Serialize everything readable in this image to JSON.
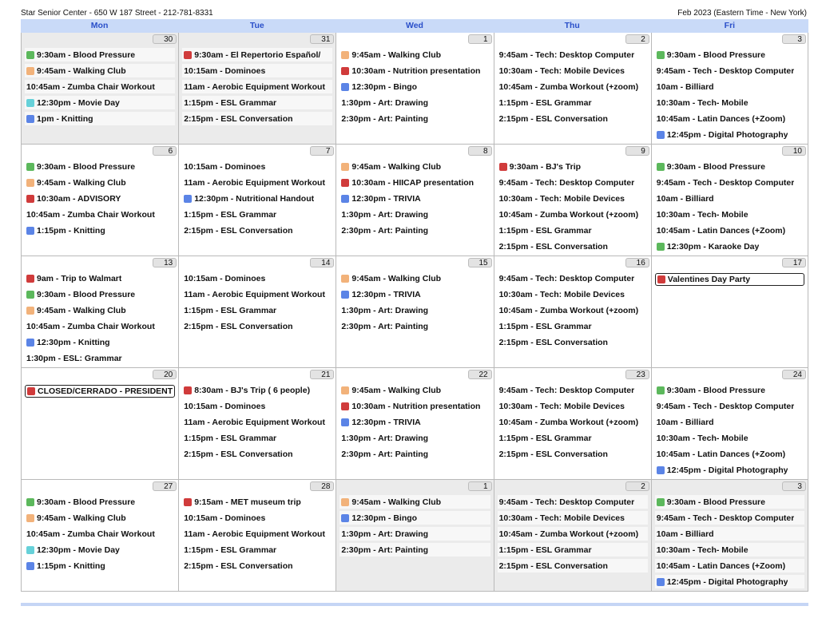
{
  "header": {
    "left": "Star Senior Center - 650 W 187 Street - 212-781-8331",
    "right": "Feb 2023 (Eastern Time - New York)"
  },
  "days_of_week": [
    "Mon",
    "Tue",
    "Wed",
    "Thu",
    "Fri"
  ],
  "weeks": [
    {
      "days": [
        {
          "num": "30",
          "gray": true,
          "events": [
            {
              "text": "9:30am - Blood Pressure",
              "color": "green"
            },
            {
              "text": "9:45am - Walking Club",
              "color": "orange"
            },
            {
              "text": "10:45am - Zumba Chair Workout"
            },
            {
              "text": "12:30pm - Movie Day",
              "color": "teal"
            },
            {
              "text": "1pm - Knitting",
              "color": "blue"
            }
          ]
        },
        {
          "num": "31",
          "gray": true,
          "events": [
            {
              "text": "9:30am - El Repertorio Español/",
              "color": "red"
            },
            {
              "text": "10:15am - Dominoes"
            },
            {
              "text": "11am - Aerobic Equipment Workout"
            },
            {
              "text": "1:15pm - ESL Grammar"
            },
            {
              "text": "2:15pm - ESL Conversation"
            }
          ]
        },
        {
          "num": "1",
          "events": [
            {
              "text": "9:45am - Walking Club",
              "color": "orange"
            },
            {
              "text": "10:30am - Nutrition presentation",
              "color": "red"
            },
            {
              "text": "12:30pm - Bingo",
              "color": "blue"
            },
            {
              "text": "1:30pm - Art: Drawing"
            },
            {
              "text": "2:30pm - Art: Painting"
            }
          ]
        },
        {
          "num": "2",
          "events": [
            {
              "text": "9:45am - Tech: Desktop Computer"
            },
            {
              "text": "10:30am - Tech: Mobile Devices"
            },
            {
              "text": "10:45am - Zumba Workout (+zoom)"
            },
            {
              "text": "1:15pm - ESL Grammar"
            },
            {
              "text": "2:15pm - ESL Conversation"
            }
          ]
        },
        {
          "num": "3",
          "events": [
            {
              "text": "9:30am - Blood Pressure",
              "color": "green"
            },
            {
              "text": "9:45am - Tech - Desktop Computer"
            },
            {
              "text": "10am - Billiard"
            },
            {
              "text": "10:30am - Tech- Mobile"
            },
            {
              "text": "10:45am - Latin Dances (+Zoom)"
            },
            {
              "text": "12:45pm - Digital Photography",
              "color": "blue"
            }
          ]
        }
      ]
    },
    {
      "days": [
        {
          "num": "6",
          "events": [
            {
              "text": "9:30am - Blood Pressure",
              "color": "green"
            },
            {
              "text": "9:45am - Walking Club",
              "color": "orange"
            },
            {
              "text": "10:30am - ADVISORY",
              "color": "red"
            },
            {
              "text": "10:45am - Zumba Chair Workout"
            },
            {
              "text": "1:15pm - Knitting",
              "color": "blue"
            }
          ]
        },
        {
          "num": "7",
          "events": [
            {
              "text": "10:15am - Dominoes"
            },
            {
              "text": "11am - Aerobic Equipment Workout"
            },
            {
              "text": "12:30pm - Nutritional Handout",
              "color": "blue"
            },
            {
              "text": "1:15pm - ESL Grammar"
            },
            {
              "text": "2:15pm - ESL Conversation"
            }
          ]
        },
        {
          "num": "8",
          "events": [
            {
              "text": "9:45am - Walking Club",
              "color": "orange"
            },
            {
              "text": "10:30am - HIICAP presentation",
              "color": "red"
            },
            {
              "text": "12:30pm - TRIVIA",
              "color": "blue"
            },
            {
              "text": "1:30pm - Art: Drawing"
            },
            {
              "text": "2:30pm - Art: Painting"
            }
          ]
        },
        {
          "num": "9",
          "events": [
            {
              "text": "9:30am - BJ's Trip",
              "color": "red"
            },
            {
              "text": "9:45am - Tech: Desktop Computer"
            },
            {
              "text": "10:30am - Tech: Mobile Devices"
            },
            {
              "text": "10:45am - Zumba Workout (+zoom)"
            },
            {
              "text": "1:15pm - ESL Grammar"
            },
            {
              "text": "2:15pm - ESL Conversation"
            }
          ]
        },
        {
          "num": "10",
          "events": [
            {
              "text": "9:30am - Blood Pressure",
              "color": "green"
            },
            {
              "text": "9:45am - Tech - Desktop Computer"
            },
            {
              "text": "10am - Billiard"
            },
            {
              "text": "10:30am - Tech- Mobile"
            },
            {
              "text": "10:45am - Latin Dances (+Zoom)"
            },
            {
              "text": "12:30pm - Karaoke Day",
              "color": "green"
            }
          ]
        }
      ]
    },
    {
      "days": [
        {
          "num": "13",
          "events": [
            {
              "text": "9am - Trip to Walmart",
              "color": "red"
            },
            {
              "text": "9:30am - Blood Pressure",
              "color": "green"
            },
            {
              "text": "9:45am - Walking Club",
              "color": "orange"
            },
            {
              "text": "10:45am - Zumba Chair Workout"
            },
            {
              "text": "12:30pm - Knitting",
              "color": "blue"
            },
            {
              "text": "1:30pm - ESL: Grammar"
            }
          ]
        },
        {
          "num": "14",
          "events": [
            {
              "text": "10:15am - Dominoes"
            },
            {
              "text": "11am - Aerobic Equipment Workout"
            },
            {
              "text": "1:15pm - ESL Grammar"
            },
            {
              "text": "2:15pm - ESL Conversation"
            }
          ]
        },
        {
          "num": "15",
          "events": [
            {
              "text": "9:45am - Walking Club",
              "color": "orange"
            },
            {
              "text": "12:30pm - TRIVIA",
              "color": "blue"
            },
            {
              "text": "1:30pm - Art: Drawing"
            },
            {
              "text": "2:30pm - Art: Painting"
            }
          ]
        },
        {
          "num": "16",
          "events": [
            {
              "text": "9:45am - Tech: Desktop Computer"
            },
            {
              "text": "10:30am - Tech: Mobile Devices"
            },
            {
              "text": "10:45am - Zumba Workout (+zoom)"
            },
            {
              "text": "1:15pm - ESL Grammar"
            },
            {
              "text": "2:15pm - ESL Conversation"
            }
          ]
        },
        {
          "num": "17",
          "events": [
            {
              "text": "Valentines Day Party",
              "color": "red",
              "boxed": true
            }
          ]
        }
      ]
    },
    {
      "days": [
        {
          "num": "20",
          "events": [
            {
              "text": "CLOSED/CERRADO - PRESIDENT'S",
              "color": "red",
              "boxed": true
            }
          ]
        },
        {
          "num": "21",
          "events": [
            {
              "text": "8:30am - BJ's Trip ( 6 people)",
              "color": "red"
            },
            {
              "text": "10:15am - Dominoes"
            },
            {
              "text": "11am - Aerobic Equipment Workout"
            },
            {
              "text": "1:15pm - ESL Grammar"
            },
            {
              "text": "2:15pm - ESL Conversation"
            }
          ]
        },
        {
          "num": "22",
          "events": [
            {
              "text": "9:45am - Walking Club",
              "color": "orange"
            },
            {
              "text": "10:30am - Nutrition presentation",
              "color": "red"
            },
            {
              "text": "12:30pm - TRIVIA",
              "color": "blue"
            },
            {
              "text": "1:30pm - Art: Drawing"
            },
            {
              "text": "2:30pm - Art: Painting"
            }
          ]
        },
        {
          "num": "23",
          "events": [
            {
              "text": "9:45am - Tech: Desktop Computer"
            },
            {
              "text": "10:30am - Tech: Mobile Devices"
            },
            {
              "text": "10:45am - Zumba Workout (+zoom)"
            },
            {
              "text": "1:15pm - ESL Grammar"
            },
            {
              "text": "2:15pm - ESL Conversation"
            }
          ]
        },
        {
          "num": "24",
          "events": [
            {
              "text": "9:30am - Blood Pressure",
              "color": "green"
            },
            {
              "text": "9:45am - Tech - Desktop Computer"
            },
            {
              "text": "10am - Billiard"
            },
            {
              "text": "10:30am - Tech- Mobile"
            },
            {
              "text": "10:45am - Latin Dances (+Zoom)"
            },
            {
              "text": "12:45pm - Digital Photography",
              "color": "blue"
            }
          ]
        }
      ]
    },
    {
      "days": [
        {
          "num": "27",
          "events": [
            {
              "text": "9:30am - Blood Pressure",
              "color": "green"
            },
            {
              "text": "9:45am - Walking Club",
              "color": "orange"
            },
            {
              "text": "10:45am - Zumba Chair Workout"
            },
            {
              "text": "12:30pm - Movie Day",
              "color": "teal"
            },
            {
              "text": "1:15pm - Knitting",
              "color": "blue"
            }
          ]
        },
        {
          "num": "28",
          "events": [
            {
              "text": "9:15am - MET museum trip",
              "color": "red"
            },
            {
              "text": "10:15am - Dominoes"
            },
            {
              "text": "11am - Aerobic Equipment Workout"
            },
            {
              "text": "1:15pm - ESL Grammar"
            },
            {
              "text": "2:15pm - ESL Conversation"
            }
          ]
        },
        {
          "num": "1",
          "gray": true,
          "events": [
            {
              "text": "9:45am - Walking Club",
              "color": "orange"
            },
            {
              "text": "12:30pm - Bingo",
              "color": "blue"
            },
            {
              "text": "1:30pm - Art: Drawing"
            },
            {
              "text": "2:30pm - Art: Painting"
            }
          ]
        },
        {
          "num": "2",
          "gray": true,
          "events": [
            {
              "text": "9:45am - Tech: Desktop Computer"
            },
            {
              "text": "10:30am - Tech: Mobile Devices"
            },
            {
              "text": "10:45am - Zumba Workout (+zoom)"
            },
            {
              "text": "1:15pm - ESL Grammar"
            },
            {
              "text": "2:15pm - ESL Conversation"
            }
          ]
        },
        {
          "num": "3",
          "gray": true,
          "events": [
            {
              "text": "9:30am - Blood Pressure",
              "color": "green"
            },
            {
              "text": "9:45am - Tech - Desktop Computer"
            },
            {
              "text": "10am - Billiard"
            },
            {
              "text": "10:30am - Tech- Mobile"
            },
            {
              "text": "10:45am - Latin Dances (+Zoom)"
            },
            {
              "text": "12:45pm - Digital Photography",
              "color": "blue"
            }
          ]
        }
      ]
    }
  ]
}
